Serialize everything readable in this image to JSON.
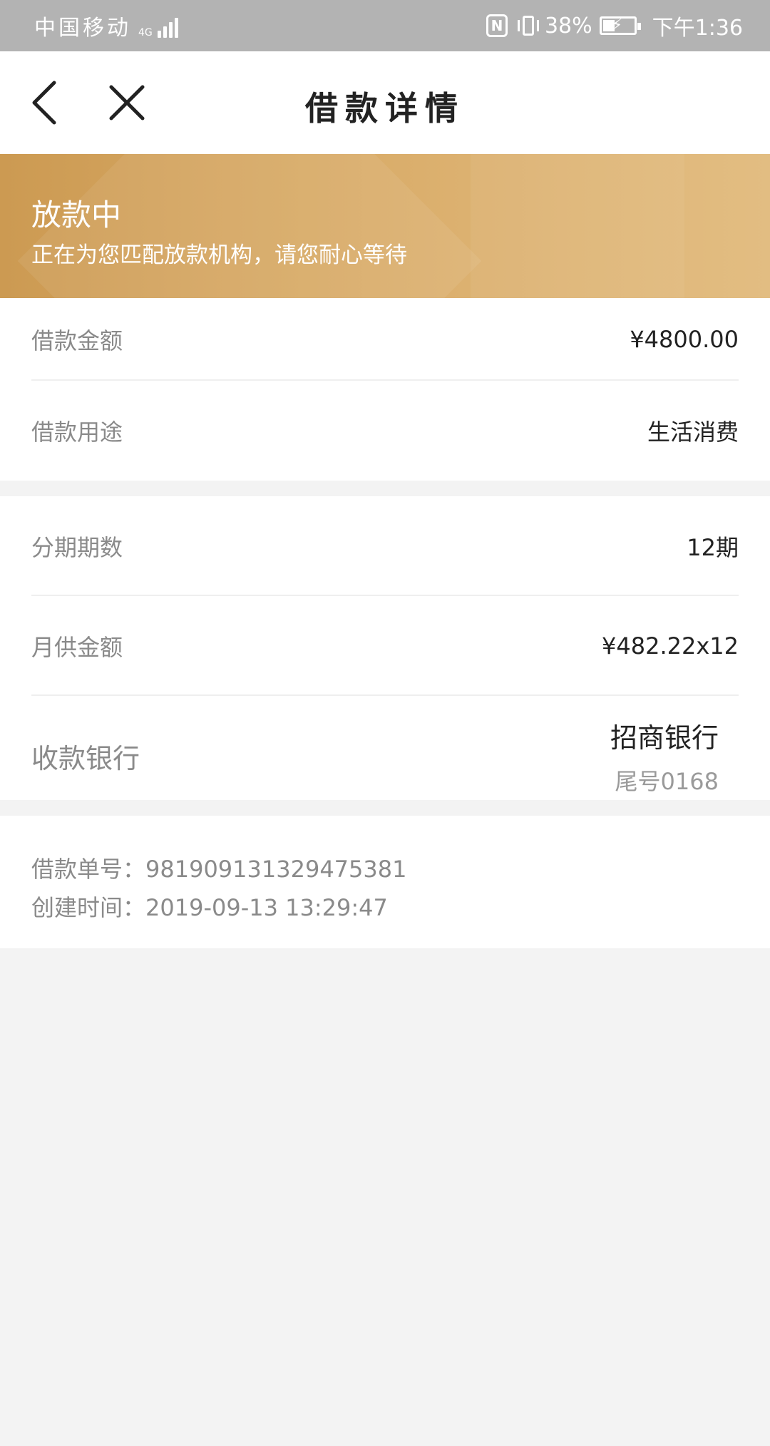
{
  "status_bar": {
    "carrier": "中国移动",
    "network": "4G",
    "battery_percent": "38%",
    "time": "下午1:36"
  },
  "navbar": {
    "title": "借款详情",
    "back_icon": "chevron-left-icon",
    "close_icon": "close-icon"
  },
  "banner": {
    "status": "放款中",
    "message": "正在为您匹配放款机构，请您耐心等待",
    "color_start": "#cc9a52",
    "color_end": "#e2bd82"
  },
  "loan": {
    "amount_label": "借款金额",
    "amount_value": "¥4800.00",
    "purpose_label": "借款用途",
    "purpose_value": "生活消费"
  },
  "repayment": {
    "periods_label": "分期期数",
    "periods_value": "12期",
    "monthly_label": "月供金额",
    "monthly_value": "¥482.22x12",
    "bank_label": "收款银行",
    "bank_name": "招商银行",
    "bank_tail": "尾号0168"
  },
  "order": {
    "number_line": "借款单号：981909131329475381",
    "created_line": "创建时间：2019-09-13 13:29:47"
  }
}
